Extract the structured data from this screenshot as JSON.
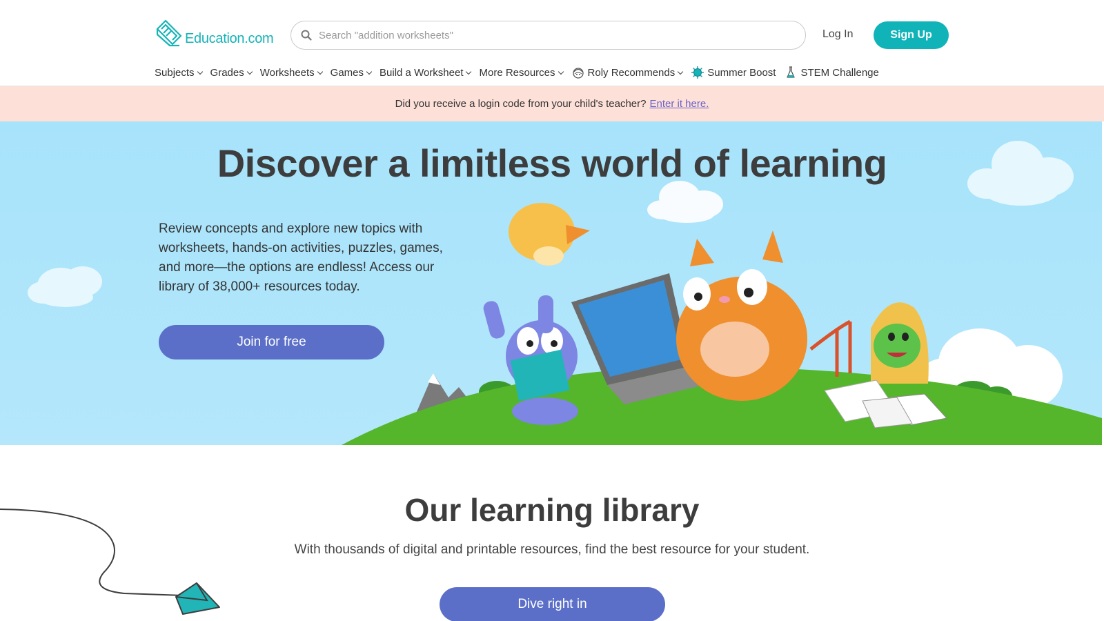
{
  "header": {
    "logo_text": "Education.com",
    "search_placeholder": "Search \"addition worksheets\"",
    "login_label": "Log In",
    "signup_label": "Sign Up"
  },
  "nav": {
    "subjects": "Subjects",
    "grades": "Grades",
    "worksheets": "Worksheets",
    "games": "Games",
    "build_worksheet": "Build a Worksheet",
    "more_resources": "More Resources",
    "roly": "Roly Recommends",
    "summer": "Summer Boost",
    "stem": "STEM Challenge"
  },
  "notice": {
    "text": "Did you receive a login code from your child's teacher?",
    "link": "Enter it here."
  },
  "hero": {
    "title": "Discover a limitless world of learning",
    "description": "Review concepts and explore new topics with worksheets, hands-on activities, puzzles, games, and more—the options are endless! Access our library of 38,000+ resources today.",
    "cta": "Join for free"
  },
  "library": {
    "title": "Our learning library",
    "subtitle": "With thousands of digital and printable resources, find the best resource for your student.",
    "cta": "Dive right in"
  },
  "colors": {
    "brand_teal": "#10b3b8",
    "button_blue": "#5b6fc8",
    "notice_bg": "#fde0d8",
    "sky": "#a7e3fb",
    "grass": "#5cb82e",
    "link_purple": "#6b63c9"
  }
}
